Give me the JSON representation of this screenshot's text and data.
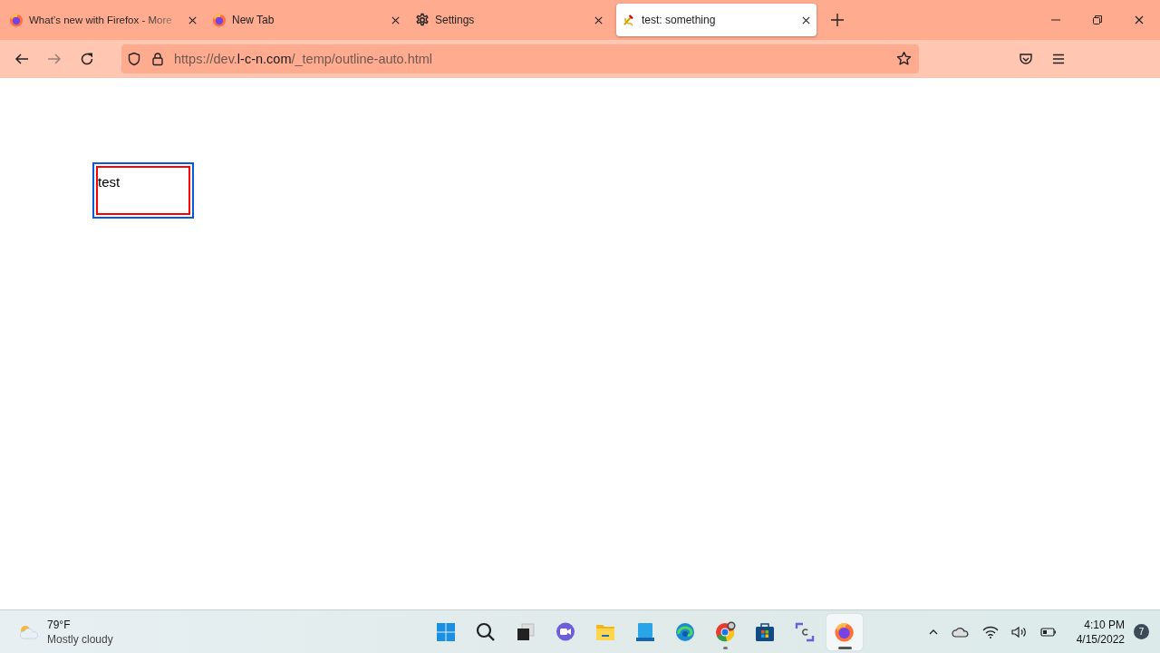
{
  "tabs": [
    {
      "kind": "firefox",
      "title": "What’s new with Firefox - More",
      "selected": false,
      "faded": true
    },
    {
      "kind": "firefox",
      "title": "New Tab",
      "selected": false,
      "faded": false
    },
    {
      "kind": "gear",
      "title": "Settings",
      "selected": false,
      "faded": false
    },
    {
      "kind": "hammer-sickle",
      "title": "test: something",
      "selected": true,
      "faded": false
    }
  ],
  "address": {
    "scheme": "https://dev.",
    "domain": "l-c-n.com",
    "path": "/_temp/outline-auto.html"
  },
  "page": {
    "box_text": "test"
  },
  "taskbar": {
    "weather": {
      "temperature": "79°F",
      "condition": "Mostly cloudy"
    },
    "apps": [
      {
        "kind": "start",
        "running": false,
        "selected": false
      },
      {
        "kind": "search",
        "running": false,
        "selected": false
      },
      {
        "kind": "taskview",
        "running": false,
        "selected": false
      },
      {
        "kind": "chat",
        "running": false,
        "selected": false
      },
      {
        "kind": "explorer",
        "running": false,
        "selected": false
      },
      {
        "kind": "monitor",
        "running": false,
        "selected": false
      },
      {
        "kind": "edge",
        "running": false,
        "selected": false
      },
      {
        "kind": "chrome",
        "running": true,
        "selected": false
      },
      {
        "kind": "store",
        "running": false,
        "selected": false
      },
      {
        "kind": "snip",
        "running": false,
        "selected": false
      },
      {
        "kind": "firefox",
        "running": true,
        "selected": true
      }
    ],
    "time": "4:10 PM",
    "date": "4/15/2022",
    "notifications": "7"
  }
}
